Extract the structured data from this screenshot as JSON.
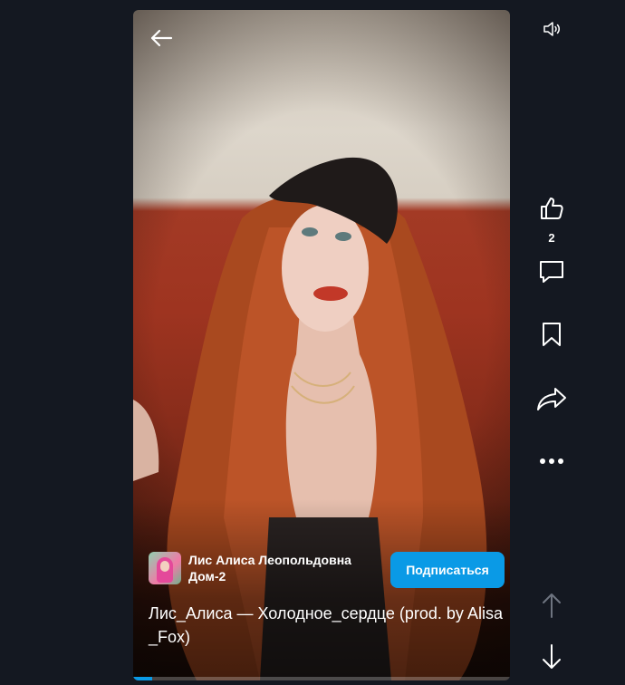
{
  "video": {
    "author_name": "Лис Алиса Леопольдовна",
    "author_channel": "Дом-2",
    "subscribe_label": "Подписаться",
    "caption": "Лис_Алиса — Холодное_сердце (prod. by Alisa_Fox)",
    "progress_percent": 5,
    "accent_color": "#0a9ae6"
  },
  "sidebar": {
    "likes": "2",
    "icons": [
      "volume-icon",
      "like-icon",
      "comment-icon",
      "bookmark-icon",
      "share-icon",
      "more-icon",
      "arrow-up-icon",
      "arrow-down-icon"
    ]
  }
}
